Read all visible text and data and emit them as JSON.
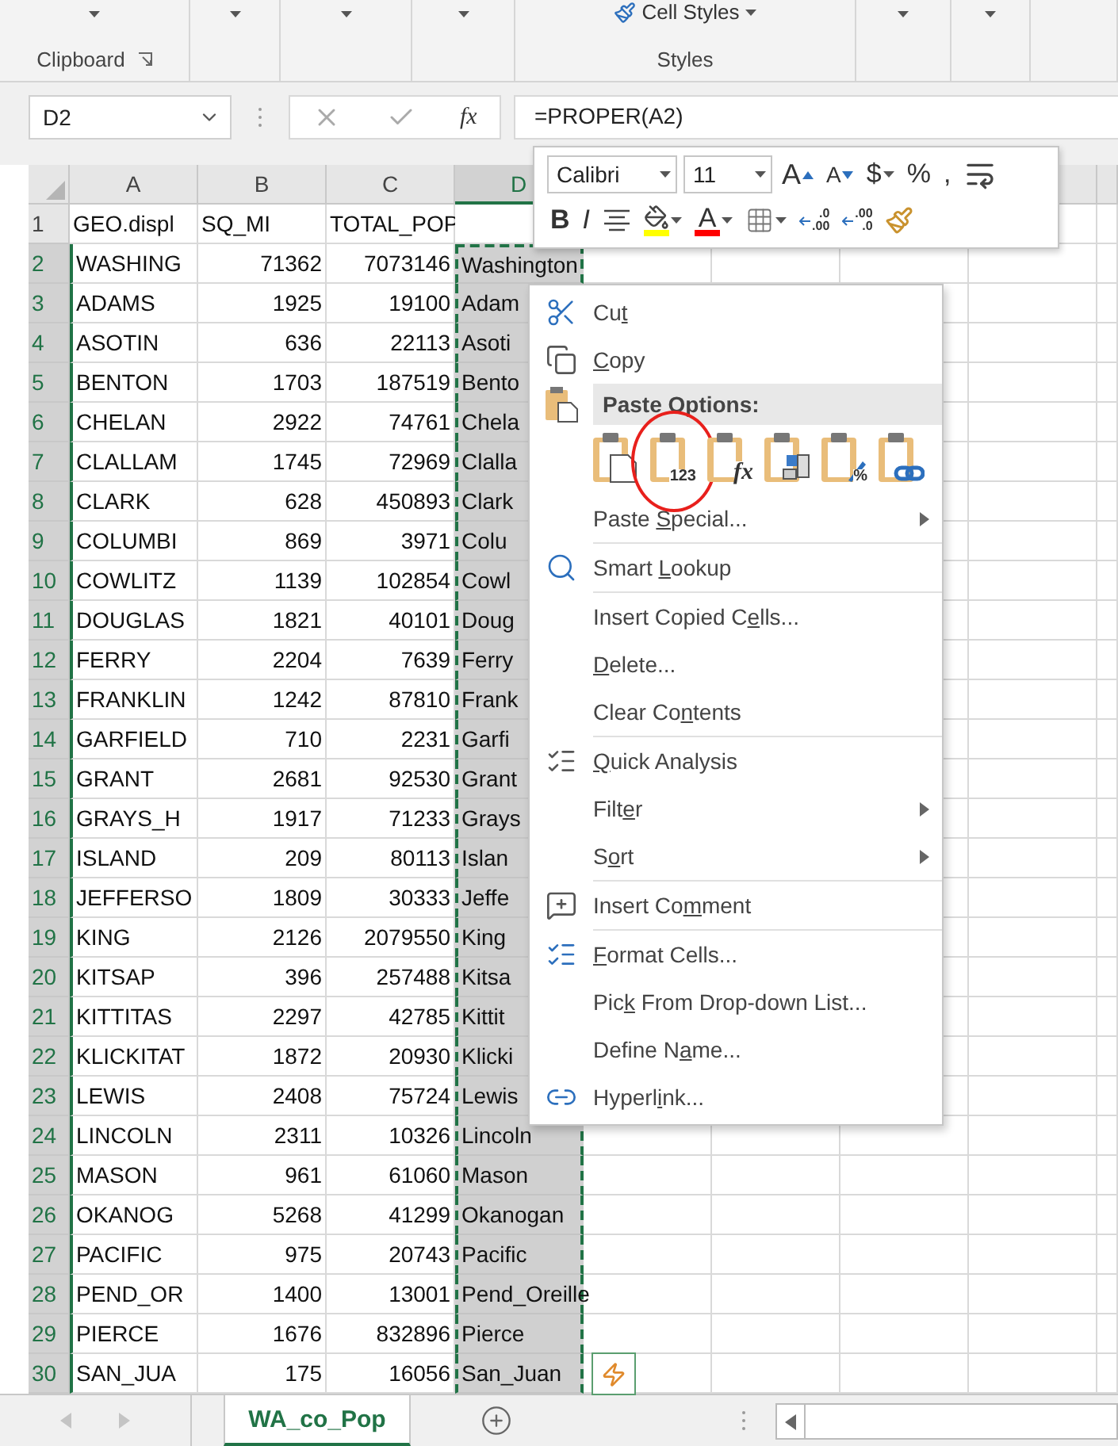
{
  "ribbon": {
    "groups": [
      {
        "label": "Clipboard",
        "launcher": true
      },
      {
        "label": "Styles",
        "button": "Cell Styles"
      }
    ]
  },
  "formula_bar": {
    "name_box": "D2",
    "fx_label": "fx",
    "formula": "=PROPER(A2)"
  },
  "columns": [
    {
      "label": "A",
      "selected": false
    },
    {
      "label": "B",
      "selected": false
    },
    {
      "label": "C",
      "selected": false
    },
    {
      "label": "D",
      "selected": true
    }
  ],
  "rows": [
    {
      "number": "1",
      "kind": "text",
      "selected": false,
      "a": "GEO.displ",
      "b": "SQ_MI",
      "c": "TOTAL_POP"
    },
    {
      "number": "2",
      "selected": true,
      "a": "WASHING",
      "b": "71362",
      "c": "7073146",
      "d": "Washington"
    },
    {
      "number": "3",
      "selected": true,
      "a": "ADAMS",
      "b": "1925",
      "c": "19100",
      "d": "Adam"
    },
    {
      "number": "4",
      "selected": true,
      "a": "ASOTIN",
      "b": "636",
      "c": "22113",
      "d": "Asoti"
    },
    {
      "number": "5",
      "selected": true,
      "a": "BENTON",
      "b": "1703",
      "c": "187519",
      "d": "Bento"
    },
    {
      "number": "6",
      "selected": true,
      "a": "CHELAN",
      "b": "2922",
      "c": "74761",
      "d": "Chela"
    },
    {
      "number": "7",
      "selected": true,
      "a": "CLALLAM",
      "b": "1745",
      "c": "72969",
      "d": "Clalla"
    },
    {
      "number": "8",
      "selected": true,
      "a": "CLARK",
      "b": "628",
      "c": "450893",
      "d": "Clark"
    },
    {
      "number": "9",
      "selected": true,
      "a": "COLUMBI",
      "b": "869",
      "c": "3971",
      "d": "Colu"
    },
    {
      "number": "10",
      "selected": true,
      "a": "COWLITZ",
      "b": "1139",
      "c": "102854",
      "d": "Cowl"
    },
    {
      "number": "11",
      "selected": true,
      "a": "DOUGLAS",
      "b": "1821",
      "c": "40101",
      "d": "Doug"
    },
    {
      "number": "12",
      "selected": true,
      "a": "FERRY",
      "b": "2204",
      "c": "7639",
      "d": "Ferry"
    },
    {
      "number": "13",
      "selected": true,
      "a": "FRANKLIN",
      "b": "1242",
      "c": "87810",
      "d": "Frank"
    },
    {
      "number": "14",
      "selected": true,
      "a": "GARFIELD",
      "b": "710",
      "c": "2231",
      "d": "Garfi"
    },
    {
      "number": "15",
      "selected": true,
      "a": "GRANT",
      "b": "2681",
      "c": "92530",
      "d": "Grant"
    },
    {
      "number": "16",
      "selected": true,
      "a": "GRAYS_H",
      "b": "1917",
      "c": "71233",
      "d": "Grays"
    },
    {
      "number": "17",
      "selected": true,
      "a": "ISLAND",
      "b": "209",
      "c": "80113",
      "d": "Islan"
    },
    {
      "number": "18",
      "selected": true,
      "a": "JEFFERSO",
      "b": "1809",
      "c": "30333",
      "d": "Jeffe"
    },
    {
      "number": "19",
      "selected": true,
      "a": "KING",
      "b": "2126",
      "c": "2079550",
      "d": "King"
    },
    {
      "number": "20",
      "selected": true,
      "a": "KITSAP",
      "b": "396",
      "c": "257488",
      "d": "Kitsa"
    },
    {
      "number": "21",
      "selected": true,
      "a": "KITTITAS",
      "b": "2297",
      "c": "42785",
      "d": "Kittit"
    },
    {
      "number": "22",
      "selected": true,
      "a": "KLICKITAT",
      "b": "1872",
      "c": "20930",
      "d": "Klicki"
    },
    {
      "number": "23",
      "selected": true,
      "a": "LEWIS",
      "b": "2408",
      "c": "75724",
      "d": "Lewis"
    },
    {
      "number": "24",
      "selected": true,
      "a": "LINCOLN",
      "b": "2311",
      "c": "10326",
      "d": "Lincoln"
    },
    {
      "number": "25",
      "selected": true,
      "a": "MASON",
      "b": "961",
      "c": "61060",
      "d": "Mason"
    },
    {
      "number": "26",
      "selected": true,
      "a": "OKANOG",
      "b": "5268",
      "c": "41299",
      "d": "Okanogan"
    },
    {
      "number": "27",
      "selected": true,
      "a": "PACIFIC",
      "b": "975",
      "c": "20743",
      "d": "Pacific"
    },
    {
      "number": "28",
      "selected": true,
      "a": "PEND_OR",
      "b": "1400",
      "c": "13001",
      "d": "Pend_Oreille"
    },
    {
      "number": "29",
      "selected": true,
      "a": "PIERCE",
      "b": "1676",
      "c": "832896",
      "d": "Pierce"
    },
    {
      "number": "30",
      "selected": true,
      "a": "SAN_JUA",
      "b": "175",
      "c": "16056",
      "d": "San_Juan"
    }
  ],
  "mini_toolbar": {
    "font": "Calibri",
    "size": "11",
    "rows": [
      [
        {
          "kind": "grow",
          "label": "A",
          "dropdown": false
        },
        {
          "kind": "shrink",
          "label": "A",
          "dropdown": false
        },
        {
          "kind": "text",
          "label": "$",
          "dropdown": true
        },
        {
          "kind": "text",
          "label": "%",
          "dropdown": false
        },
        {
          "kind": "text",
          "label": ",",
          "dropdown": false
        },
        {
          "kind": "wrap",
          "dropdown": false
        }
      ],
      [
        {
          "kind": "bold",
          "label": "B",
          "dropdown": false
        },
        {
          "kind": "italic",
          "label": "I",
          "dropdown": false
        },
        {
          "kind": "align",
          "dropdown": false
        },
        {
          "kind": "fill",
          "color": "#ffff00",
          "dropdown": true
        },
        {
          "kind": "fontcolor",
          "label": "A",
          "color": "#ff0000",
          "dropdown": true
        },
        {
          "kind": "borders",
          "dropdown": true
        },
        {
          "kind": "decimal",
          "top": ".0",
          "bottom": ".00",
          "dropdown": false
        },
        {
          "kind": "decimal",
          "top": ".00",
          "bottom": ".0",
          "dropdown": false
        },
        {
          "kind": "painter",
          "dropdown": false
        }
      ]
    ]
  },
  "context_menu": {
    "items": [
      {
        "kind": "cut",
        "key": "Cu",
        "accel": "t",
        "submenu": false,
        "separator_before": false
      },
      {
        "kind": "copy",
        "accel": "C",
        "post": "opy",
        "submenu": false,
        "separator_before": false
      },
      {
        "kind": "paste_header",
        "label": "Paste Options:"
      },
      {
        "kind": "paste_icons",
        "options": [
          {
            "kind": "paste",
            "circled": false
          },
          {
            "kind": "values",
            "label": "123",
            "circled": true
          },
          {
            "kind": "formulas",
            "label": "fx",
            "circled": false
          },
          {
            "kind": "transpose",
            "circled": false
          },
          {
            "kind": "formatting",
            "label": "%",
            "circled": false
          },
          {
            "kind": "link",
            "circled": false
          }
        ]
      },
      {
        "kind": "plain",
        "key": "Paste ",
        "accel": "S",
        "post": "pecial...",
        "submenu": true,
        "separator_before": false
      },
      {
        "kind": "lookup",
        "key": "Smart ",
        "accel": "L",
        "post": "ookup",
        "submenu": false,
        "separator_before": true
      },
      {
        "kind": "plain",
        "key": "Insert Copied C",
        "accel": "e",
        "post": "lls...",
        "submenu": false,
        "separator_before": true
      },
      {
        "kind": "plain",
        "accel": "D",
        "post": "elete...",
        "submenu": false,
        "separator_before": false
      },
      {
        "kind": "plain",
        "key": "Clear Co",
        "accel": "n",
        "post": "tents",
        "submenu": false,
        "separator_before": false
      },
      {
        "kind": "analysis",
        "accel": "Q",
        "post": "uick Analysis",
        "submenu": false,
        "separator_before": true
      },
      {
        "kind": "plain",
        "key": "Filt",
        "accel": "e",
        "post": "r",
        "submenu": true,
        "separator_before": false
      },
      {
        "kind": "plain",
        "key": "S",
        "accel": "o",
        "post": "rt",
        "submenu": true,
        "separator_before": false
      },
      {
        "kind": "comment",
        "key": "Insert Co",
        "accel": "m",
        "post": "ment",
        "submenu": false,
        "separator_before": true
      },
      {
        "kind": "format",
        "accel": "F",
        "post": "ormat Cells...",
        "submenu": false,
        "separator_before": true
      },
      {
        "kind": "plain",
        "key": "Pic",
        "accel": "k",
        "post": " From Drop-down List...",
        "submenu": false,
        "separator_before": false
      },
      {
        "kind": "plain",
        "key": "Define N",
        "accel": "a",
        "post": "me...",
        "submenu": false,
        "separator_before": false
      },
      {
        "kind": "link",
        "key": "Hyperl",
        "accel": "i",
        "post": "nk...",
        "submenu": false,
        "separator_before": false
      }
    ]
  },
  "sheet_tabs": [
    {
      "label": "WA_co_Pop",
      "selected": true
    }
  ]
}
